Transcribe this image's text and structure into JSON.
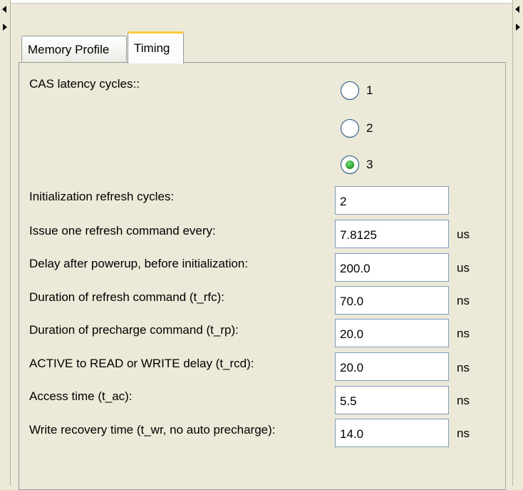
{
  "tabs": [
    {
      "label": "Memory Profile",
      "selected": false
    },
    {
      "label": "Timing",
      "selected": true
    }
  ],
  "colors": {
    "tab_accent": "#ffc83c",
    "field_border": "#7f9db9",
    "radio_checked": "#1f9a1f",
    "background": "#ece9d8"
  },
  "cas_latency": {
    "label": "CAS latency cycles::",
    "options": [
      {
        "label": "1",
        "checked": false
      },
      {
        "label": "2",
        "checked": false
      },
      {
        "label": "3",
        "checked": true
      }
    ]
  },
  "fields": [
    {
      "label": "Initialization refresh cycles:",
      "value": "2",
      "unit": ""
    },
    {
      "label": "Issue one refresh command every:",
      "value": "7.8125",
      "unit": "us"
    },
    {
      "label": "Delay after powerup, before initialization:",
      "value": "200.0",
      "unit": "us"
    },
    {
      "label": "Duration of refresh command (t_rfc):",
      "value": "70.0",
      "unit": "ns"
    },
    {
      "label": "Duration of precharge command (t_rp):",
      "value": "20.0",
      "unit": "ns"
    },
    {
      "label": "ACTIVE to READ or WRITE delay (t_rcd):",
      "value": "20.0",
      "unit": "ns"
    },
    {
      "label": "Access time (t_ac):",
      "value": "5.5",
      "unit": "ns"
    },
    {
      "label": "Write recovery time (t_wr, no auto precharge):",
      "value": "14.0",
      "unit": "ns"
    }
  ]
}
